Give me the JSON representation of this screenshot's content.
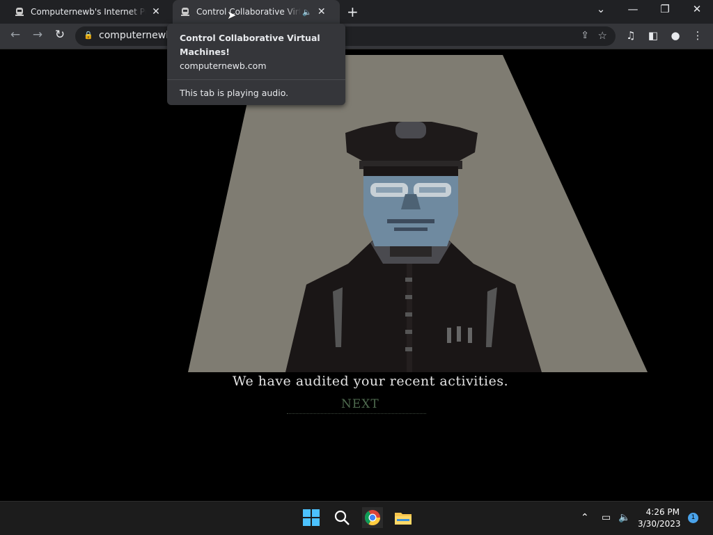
{
  "browser": {
    "tabs": [
      {
        "title": "Computernewb's Internet Pub Hub",
        "icon": "computernewb-favicon"
      },
      {
        "title": "Control Collaborative Virtual Machines!",
        "icon": "computernewb-favicon",
        "audio": true
      }
    ],
    "new_tab_label": "+",
    "address": {
      "url": "computernewb.com",
      "lock_icon": "lock-icon"
    }
  },
  "hovercard": {
    "title": "Control Collaborative Virtual Machines!",
    "domain": "computernewb.com",
    "audio_text": "This tab is playing audio."
  },
  "game": {
    "caption": "We have audited your recent activities.",
    "next_label": "NEXT",
    "colors": {
      "spotlight": "#7f7c72",
      "skin": "#6f8aa0",
      "uniform": "#1a1616",
      "next": "#4e6a4e"
    }
  },
  "taskbar": {
    "apps": [
      "windows-start-icon",
      "search-icon",
      "chrome-icon",
      "file-explorer-icon"
    ],
    "time": "4:26 PM",
    "date": "3/30/2023",
    "notification_count": "1"
  }
}
